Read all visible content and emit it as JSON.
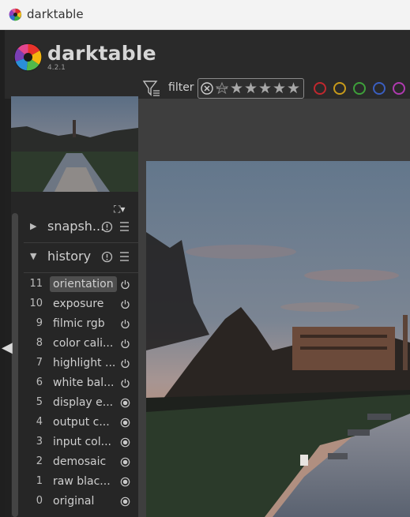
{
  "window": {
    "title": "darktable"
  },
  "header": {
    "brand": "darktable",
    "version": "4.2.1"
  },
  "toolbar": {
    "filter_label": "filter",
    "rating_stars": [
      "★",
      "★",
      "★",
      "★",
      "★"
    ],
    "color_labels": [
      "#c0282e",
      "#c89a1a",
      "#3ea03a",
      "#3a5ec0",
      "#b03ab0"
    ]
  },
  "thumbnail_tools": {
    "expand": "⛶▾"
  },
  "modules": {
    "snapshots": {
      "label": "snapsh...",
      "arrow": "▶"
    },
    "history": {
      "label": "history",
      "arrow": "▼"
    }
  },
  "history": {
    "items": [
      {
        "num": "11",
        "label": "orientation",
        "state": "power",
        "selected": true
      },
      {
        "num": "10",
        "label": "exposure",
        "state": "power"
      },
      {
        "num": "9",
        "label": "filmic rgb",
        "state": "power"
      },
      {
        "num": "8",
        "label": "color cali...",
        "state": "power"
      },
      {
        "num": "7",
        "label": "highlight ...",
        "state": "power"
      },
      {
        "num": "6",
        "label": "white bal...",
        "state": "power"
      },
      {
        "num": "5",
        "label": "display e...",
        "state": "locked"
      },
      {
        "num": "4",
        "label": "output c...",
        "state": "locked"
      },
      {
        "num": "3",
        "label": "input col...",
        "state": "locked"
      },
      {
        "num": "2",
        "label": "demosaic",
        "state": "locked"
      },
      {
        "num": "1",
        "label": "raw blac...",
        "state": "locked"
      },
      {
        "num": "0",
        "label": "original",
        "state": "locked"
      }
    ]
  }
}
